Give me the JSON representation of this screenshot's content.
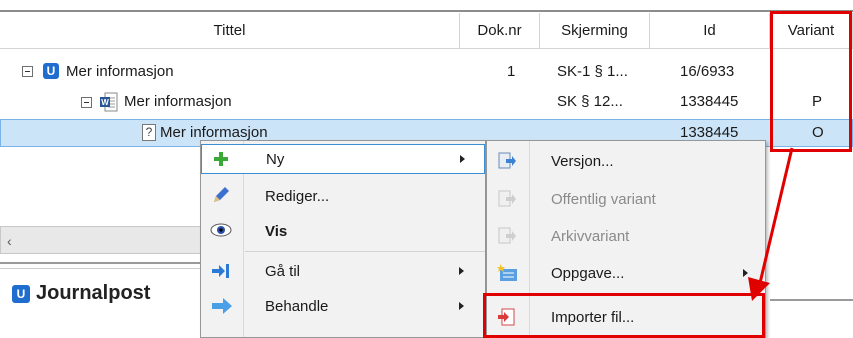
{
  "table": {
    "columns": [
      "Tittel",
      "Dok.nr",
      "Skjerming",
      "Id",
      "Variant"
    ],
    "rows": [
      {
        "title": "Mer informasjon",
        "doknr": "1",
        "skjerming": "SK-1 § 1...",
        "id": "16/6933",
        "variant": ""
      },
      {
        "title": "Mer informasjon",
        "doknr": "",
        "skjerming": "SK § 12...",
        "id": "1338445",
        "variant": "P"
      },
      {
        "title": "Mer informasjon",
        "doknr": "",
        "skjerming": "",
        "id": "1338445",
        "variant": "O"
      }
    ],
    "row_icons": [
      "u-badge-icon",
      "word-document-icon",
      "unknown-file-icon"
    ]
  },
  "journalpost": {
    "title": "Journalpost",
    "icon": "u-badge-icon"
  },
  "context_menu": {
    "items": [
      {
        "label": "Ny",
        "icon": "green-plus-icon",
        "submenu": true
      },
      {
        "label": "Rediger...",
        "icon": "pencil-icon",
        "submenu": false
      },
      {
        "label": "Vis",
        "icon": "eye-icon",
        "submenu": false
      },
      {
        "label": "Gå til",
        "icon": "goto-arrow-icon",
        "submenu": true
      },
      {
        "label": "Behandle",
        "icon": "process-arrow-icon",
        "submenu": true
      }
    ]
  },
  "submenu": {
    "items": [
      {
        "label": "Versjon...",
        "icon": "version-doc-icon",
        "enabled": true
      },
      {
        "label": "Offentlig variant",
        "icon": "doc-icon",
        "enabled": false
      },
      {
        "label": "Arkivvariant",
        "icon": "doc-icon",
        "enabled": false
      },
      {
        "label": "Oppgave...",
        "icon": "task-icon",
        "enabled": true,
        "submenu": true
      },
      {
        "label": "Importer fil...",
        "icon": "import-file-icon",
        "enabled": true
      }
    ]
  },
  "colors": {
    "highlight": "#e00000",
    "selection": "#cce4f7",
    "accent": "#1f6ecf"
  }
}
